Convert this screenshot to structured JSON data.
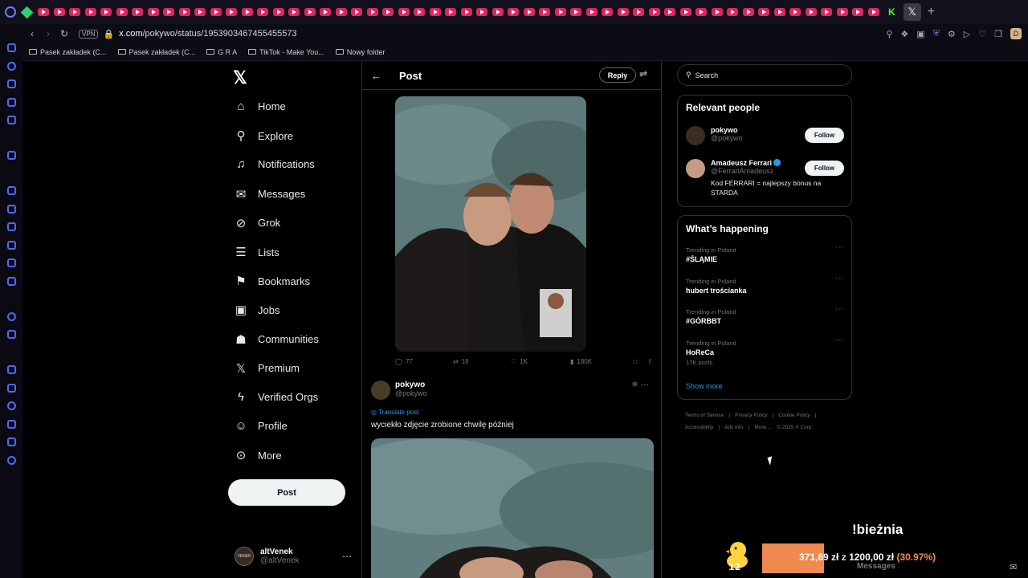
{
  "browser": {
    "url_host": "x.com",
    "url_path": "/pokywo/status/1953903467455455573",
    "vpn_label": "VPN",
    "profile_initial": "D",
    "bookmarks": [
      "Pasek zakładek (C...",
      "Pasek zakładek (C...",
      "G R A",
      "TikTok - Make You...",
      "Nowy folder"
    ]
  },
  "x_nav": {
    "items": [
      {
        "label": "Home",
        "icon": "home-icon"
      },
      {
        "label": "Explore",
        "icon": "search-icon"
      },
      {
        "label": "Notifications",
        "icon": "bell-icon"
      },
      {
        "label": "Messages",
        "icon": "mail-icon"
      },
      {
        "label": "Grok",
        "icon": "grok-icon"
      },
      {
        "label": "Lists",
        "icon": "list-icon"
      },
      {
        "label": "Bookmarks",
        "icon": "bookmark-icon"
      },
      {
        "label": "Jobs",
        "icon": "briefcase-icon"
      },
      {
        "label": "Communities",
        "icon": "communities-icon"
      },
      {
        "label": "Premium",
        "icon": "x-logo-icon"
      },
      {
        "label": "Verified Orgs",
        "icon": "lightning-icon"
      },
      {
        "label": "Profile",
        "icon": "person-icon"
      },
      {
        "label": "More",
        "icon": "more-circle-icon"
      }
    ],
    "post_label": "Post",
    "account_name": "altVenek",
    "account_handle": "@altVenek"
  },
  "post": {
    "header_title": "Post",
    "reply_label": "Reply",
    "stats": {
      "replies": "77",
      "reposts": "19",
      "likes": "1K",
      "views": "180K"
    },
    "reply_tweet": {
      "name": "pokywo",
      "handle": "@pokywo",
      "translate": "Translate post",
      "text": "wyciekło zdjęcie zrobione chwilę później"
    }
  },
  "sidebar": {
    "search_placeholder": "Search",
    "relevant_title": "Relevant people",
    "people": [
      {
        "name": "pokywo",
        "handle": "@pokywo",
        "bio": "",
        "verified": false,
        "follow": "Follow"
      },
      {
        "name": "Amadeusz Ferrari",
        "handle": "@FerrariAmadeusz",
        "bio": "Kod FERRARI = najlepszy bonus na STARDA",
        "verified": true,
        "follow": "Follow"
      }
    ],
    "happening_title": "What’s happening",
    "trends": [
      {
        "context": "Trending in Poland",
        "name": "#ŚLĄMIE",
        "posts": ""
      },
      {
        "context": "Trending in Poland",
        "name": "hubert trościanka",
        "posts": ""
      },
      {
        "context": "Trending in Poland",
        "name": "#GÓRBBT",
        "posts": ""
      },
      {
        "context": "Trending in Poland",
        "name": "HoReCa",
        "posts": "17K posts"
      }
    ],
    "show_more": "Show more",
    "footer_links": [
      "Terms of Service",
      "|",
      "Privacy Policy",
      "|",
      "Cookie Policy",
      "|",
      "Accessibility",
      "|",
      "Ads info",
      "|",
      "More ...",
      "© 2025 X Corp."
    ]
  },
  "overlay": {
    "title": "!bieżnia",
    "amount": "371,69 zł",
    "sep": "z",
    "goal": "1200,00 zł",
    "percent_label": "(30.97%)",
    "progress": 0.3097,
    "duck_number": "12",
    "messages_label": "Messages"
  }
}
